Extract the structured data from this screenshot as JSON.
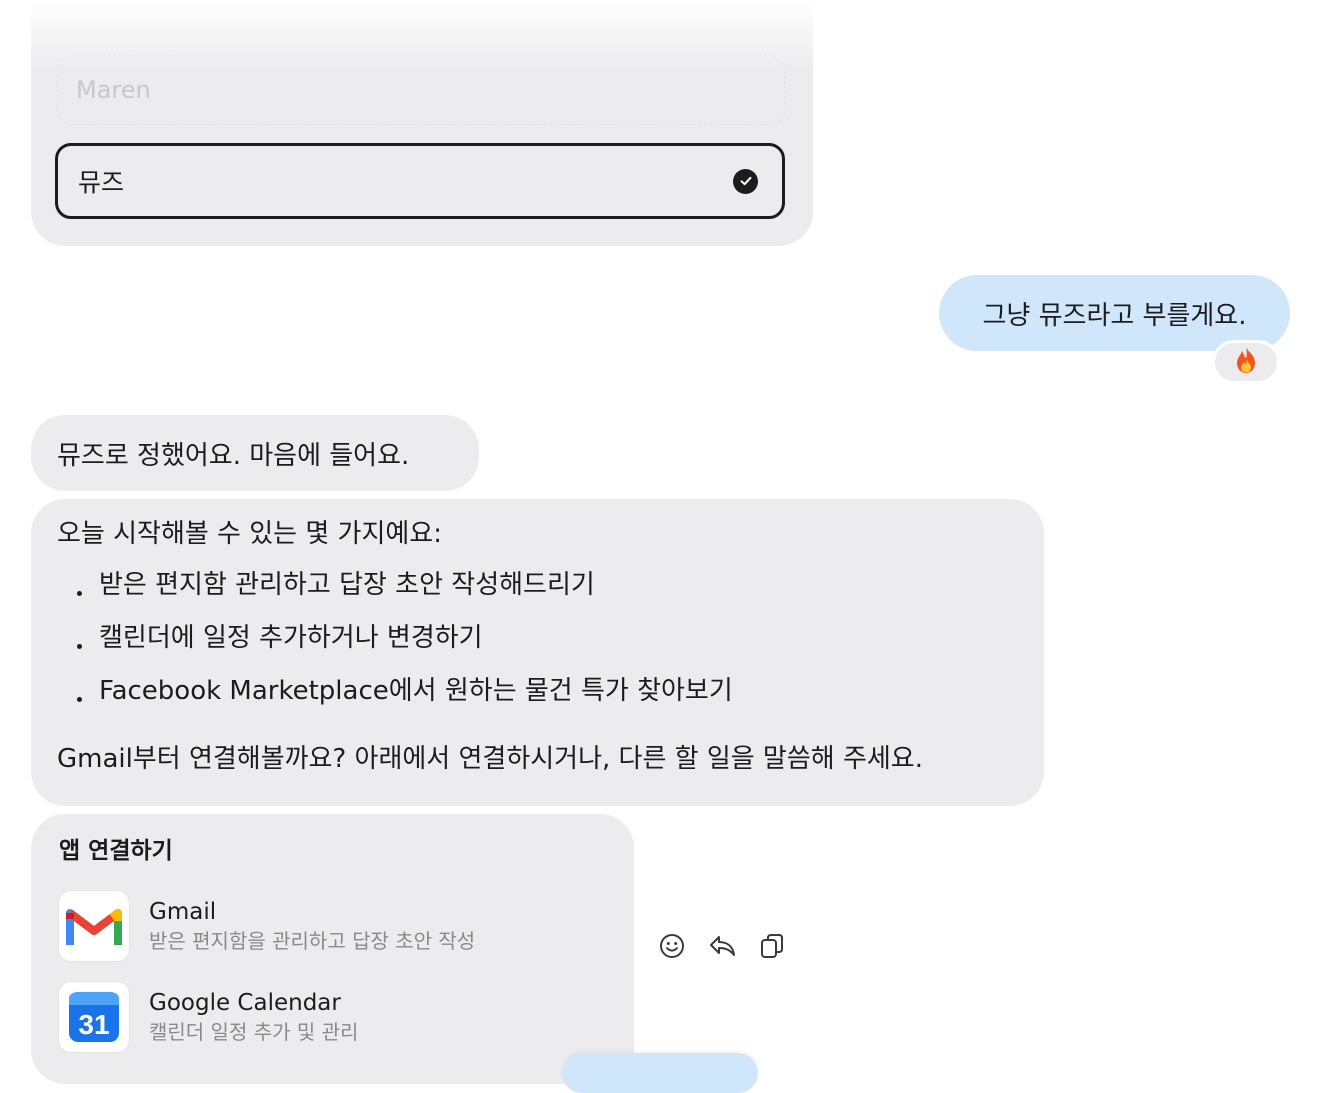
{
  "name_picker": {
    "faded_option": "Maren",
    "selected_option": "뮤즈"
  },
  "user_message": {
    "text": "그냥 뮤즈라고 부를게요.",
    "reaction_icon": "fire-icon"
  },
  "assistant": {
    "message1": "뮤즈로 정했어요. 마음에 들어요.",
    "message2": {
      "intro": "오늘 시작해볼 수 있는 몇 가지예요:",
      "items": [
        "받은 편지함 관리하고 답장 초안 작성해드리기",
        "캘린더에 일정 추가하거나 변경하기",
        "Facebook Marketplace에서 원하는 물건 특가 찾아보기"
      ],
      "outro": "Gmail부터 연결해볼까요? 아래에서 연결하시거나, 다른 할 일을 말씀해 주세요."
    },
    "connect_card": {
      "heading": "앱 연결하기",
      "apps": [
        {
          "name": "Gmail",
          "desc": "받은 편지함을 관리하고 답장 초안 작성",
          "icon": "gmail-icon"
        },
        {
          "name": "Google Calendar",
          "desc": "캘린더 일정 추가 및 관리",
          "icon": "google-calendar-icon",
          "icon_text": "31"
        }
      ]
    }
  },
  "actions": [
    "emoji-reaction-icon",
    "reply-icon",
    "copy-icon"
  ],
  "colors": {
    "assistant_bubble": "#ececee",
    "user_bubble": "#cfe6fb",
    "text": "#1c1c1e",
    "muted_text": "#8a8a8e"
  }
}
